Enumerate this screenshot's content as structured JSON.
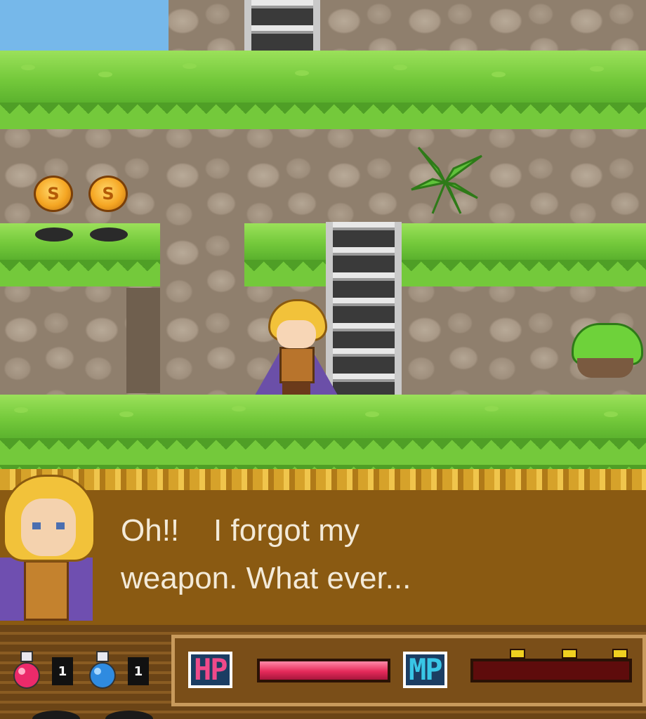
{
  "dialog": {
    "speaker_portrait": "hero-portrait",
    "text": "Oh!!    I forgot my\nweapon. What ever..."
  },
  "inventory": {
    "red_potion": {
      "icon": "red-potion-icon",
      "count": "1"
    },
    "blue_potion": {
      "icon": "blue-potion-icon",
      "count": "1"
    }
  },
  "status": {
    "hp_label": "HP",
    "mp_label": "MP",
    "hp_fill": 1.0,
    "mp_fill": 0.0
  },
  "scene": {
    "coins": [
      {
        "symbol": "S"
      },
      {
        "symbol": "S"
      }
    ],
    "colors": {
      "grass": "#74c93b",
      "rock": "#8f7f6d",
      "dialog_bg": "#8a5a12",
      "hp": "#e52a5a",
      "mp_empty": "#5e0c0c"
    }
  }
}
